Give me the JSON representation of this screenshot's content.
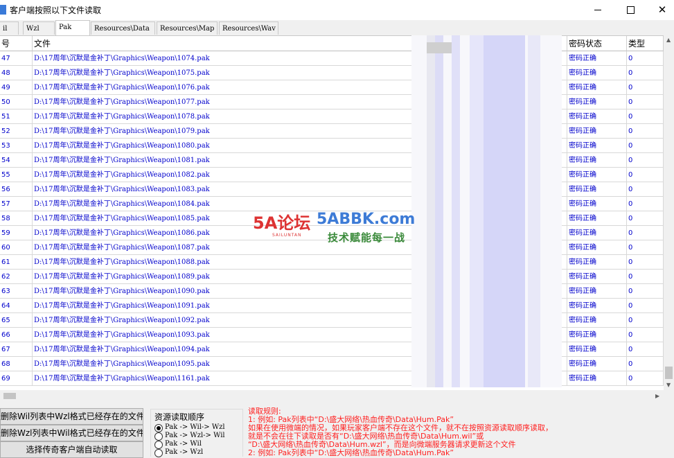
{
  "window": {
    "title": "客户端按照以下文件读取",
    "close_glyph": "✕"
  },
  "tabs": [
    "il",
    "Wzl",
    "Pak",
    "Resources\\Data",
    "Resources\\Map",
    "Resources\\Wav"
  ],
  "active_tab": "Pak",
  "table": {
    "columns": {
      "index": "号",
      "file": "文件",
      "status": "密码状态",
      "type": "类型"
    },
    "rows": [
      {
        "index": "47",
        "file": "D:\\17周年\\沉默是金补丁\\Graphics\\Weapon\\1074.pak",
        "status": "密码正确",
        "type": "0"
      },
      {
        "index": "48",
        "file": "D:\\17周年\\沉默是金补丁\\Graphics\\Weapon\\1075.pak",
        "status": "密码正确",
        "type": "0"
      },
      {
        "index": "49",
        "file": "D:\\17周年\\沉默是金补丁\\Graphics\\Weapon\\1076.pak",
        "status": "密码正确",
        "type": "0"
      },
      {
        "index": "50",
        "file": "D:\\17周年\\沉默是金补丁\\Graphics\\Weapon\\1077.pak",
        "status": "密码正确",
        "type": "0"
      },
      {
        "index": "51",
        "file": "D:\\17周年\\沉默是金补丁\\Graphics\\Weapon\\1078.pak",
        "status": "密码正确",
        "type": "0"
      },
      {
        "index": "52",
        "file": "D:\\17周年\\沉默是金补丁\\Graphics\\Weapon\\1079.pak",
        "status": "密码正确",
        "type": "0"
      },
      {
        "index": "53",
        "file": "D:\\17周年\\沉默是金补丁\\Graphics\\Weapon\\1080.pak",
        "status": "密码正确",
        "type": "0"
      },
      {
        "index": "54",
        "file": "D:\\17周年\\沉默是金补丁\\Graphics\\Weapon\\1081.pak",
        "status": "密码正确",
        "type": "0"
      },
      {
        "index": "55",
        "file": "D:\\17周年\\沉默是金补丁\\Graphics\\Weapon\\1082.pak",
        "status": "密码正确",
        "type": "0"
      },
      {
        "index": "56",
        "file": "D:\\17周年\\沉默是金补丁\\Graphics\\Weapon\\1083.pak",
        "status": "密码正确",
        "type": "0"
      },
      {
        "index": "57",
        "file": "D:\\17周年\\沉默是金补丁\\Graphics\\Weapon\\1084.pak",
        "status": "密码正确",
        "type": "0"
      },
      {
        "index": "58",
        "file": "D:\\17周年\\沉默是金补丁\\Graphics\\Weapon\\1085.pak",
        "status": "密码正确",
        "type": "0"
      },
      {
        "index": "59",
        "file": "D:\\17周年\\沉默是金补丁\\Graphics\\Weapon\\1086.pak",
        "status": "密码正确",
        "type": "0"
      },
      {
        "index": "60",
        "file": "D:\\17周年\\沉默是金补丁\\Graphics\\Weapon\\1087.pak",
        "status": "密码正确",
        "type": "0"
      },
      {
        "index": "61",
        "file": "D:\\17周年\\沉默是金补丁\\Graphics\\Weapon\\1088.pak",
        "status": "密码正确",
        "type": "0"
      },
      {
        "index": "62",
        "file": "D:\\17周年\\沉默是金补丁\\Graphics\\Weapon\\1089.pak",
        "status": "密码正确",
        "type": "0"
      },
      {
        "index": "63",
        "file": "D:\\17周年\\沉默是金补丁\\Graphics\\Weapon\\1090.pak",
        "status": "密码正确",
        "type": "0"
      },
      {
        "index": "64",
        "file": "D:\\17周年\\沉默是金补丁\\Graphics\\Weapon\\1091.pak",
        "status": "密码正确",
        "type": "0"
      },
      {
        "index": "65",
        "file": "D:\\17周年\\沉默是金补丁\\Graphics\\Weapon\\1092.pak",
        "status": "密码正确",
        "type": "0"
      },
      {
        "index": "66",
        "file": "D:\\17周年\\沉默是金补丁\\Graphics\\Weapon\\1093.pak",
        "status": "密码正确",
        "type": "0"
      },
      {
        "index": "67",
        "file": "D:\\17周年\\沉默是金补丁\\Graphics\\Weapon\\1094.pak",
        "status": "密码正确",
        "type": "0"
      },
      {
        "index": "68",
        "file": "D:\\17周年\\沉默是金补丁\\Graphics\\Weapon\\1095.pak",
        "status": "密码正确",
        "type": "0"
      },
      {
        "index": "69",
        "file": "D:\\17周年\\沉默是金补丁\\Graphics\\Weapon\\1161.pak",
        "status": "密码正确",
        "type": "0"
      }
    ]
  },
  "watermark": {
    "badge": "5A论坛",
    "badge_sub": "SAILUNTAN",
    "site": "5ABBK.com",
    "slogan": "技术赋能每一战"
  },
  "buttons": {
    "delete_wil": "删除Wil列表中Wzl格式已经存在的文件",
    "delete_wzl": "删除Wzl列表中Wil格式已经存在的文件",
    "auto_read": "选择传奇客户端自动读取"
  },
  "resource_order": {
    "title": "资源读取顺序",
    "options": [
      "Pak -> Wil-> Wzl",
      "Pak -> Wzl-> Wil",
      "Pak -> Wil",
      "Pak -> Wzl"
    ],
    "selected": 0
  },
  "rules": [
    "读取规则:",
    "1: 例如: Pak列表中“D:\\盛大网络\\热血传奇\\Data\\Hum.Pak”",
    "    如果在使用微端的情况，如果玩家客户端不存在这个文件，就不在按照资源读取顺序读取，",
    "    就是不会在往下读取是否有“D:\\盛大网络\\热血传奇\\Data\\Hum.wil”或",
    "  “D:\\盛大网络\\热血传奇\\Data\\Hum.wzl”，而是向微端服务器请求更新这个文件",
    "2: 例如: Pak列表中“D:\\盛大网络\\热血传奇\\Data\\Hum.Pak”"
  ],
  "colors": {
    "link_blue": "#0000cc",
    "rules_red": "#ff2020",
    "blur_tint": "#c9cbf7"
  }
}
